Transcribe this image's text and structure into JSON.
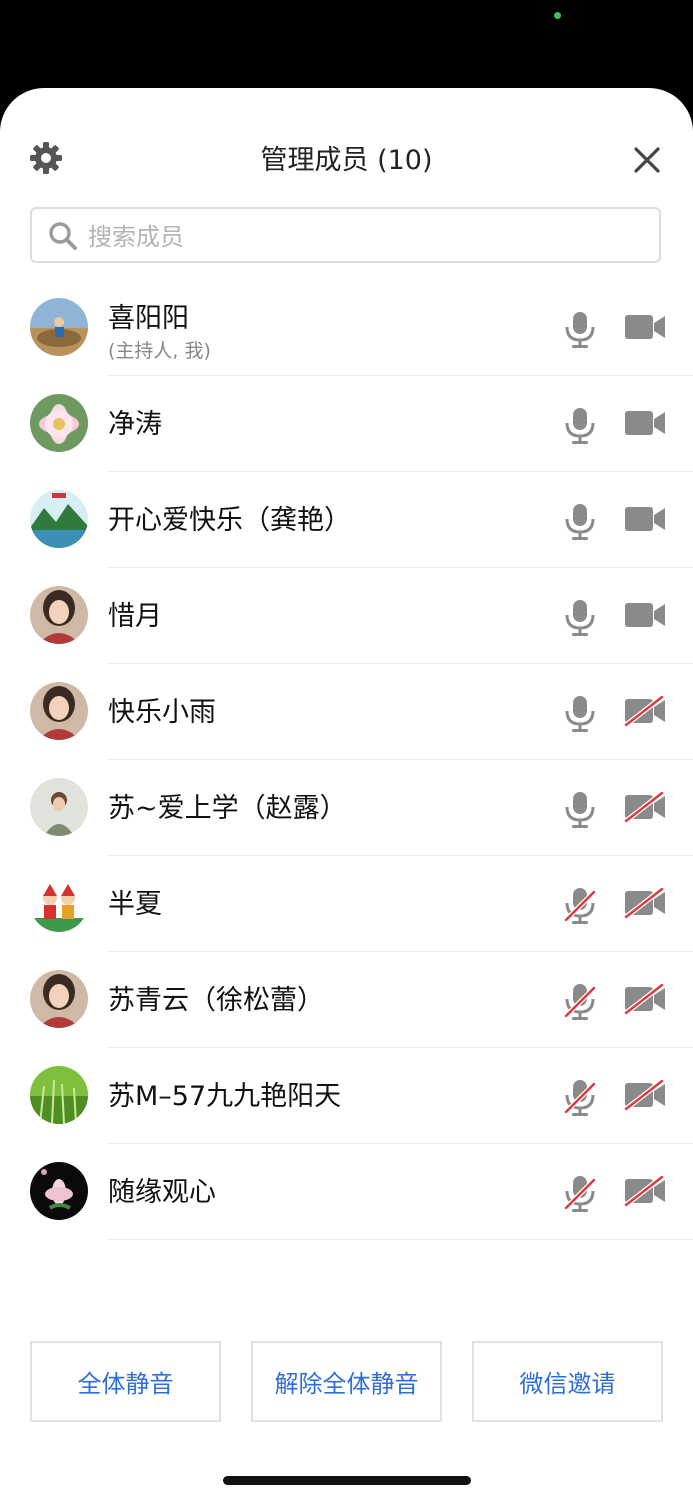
{
  "title": "管理成员 (10)",
  "search": {
    "placeholder": "搜索成员"
  },
  "members": [
    {
      "name": "喜阳阳",
      "sub": "(主持人, 我)",
      "avatar_icon": "landscape-person-avatar",
      "mic_on": true,
      "cam_on": true
    },
    {
      "name": "净涛",
      "avatar_icon": "lotus-flower-avatar",
      "mic_on": true,
      "cam_on": true
    },
    {
      "name": "开心爱快乐（龚艳）",
      "avatar_icon": "mountain-lake-avatar",
      "mic_on": true,
      "cam_on": true
    },
    {
      "name": "惜月",
      "avatar_icon": "woman-portrait-avatar",
      "mic_on": true,
      "cam_on": true
    },
    {
      "name": "快乐小雨",
      "avatar_icon": "woman-portrait-avatar",
      "mic_on": true,
      "cam_on": false
    },
    {
      "name": "苏~爱上学（赵露）",
      "avatar_icon": "person-photo-avatar",
      "mic_on": true,
      "cam_on": false
    },
    {
      "name": "半夏",
      "avatar_icon": "christmas-children-avatar",
      "mic_on": false,
      "cam_on": false
    },
    {
      "name": "苏青云（徐松蕾）",
      "avatar_icon": "woman-portrait-avatar",
      "mic_on": false,
      "cam_on": false
    },
    {
      "name": "苏M–57九九艳阳天",
      "avatar_icon": "green-grass-avatar",
      "mic_on": false,
      "cam_on": false
    },
    {
      "name": "随缘观心",
      "avatar_icon": "lotus-dark-avatar",
      "mic_on": false,
      "cam_on": false
    }
  ],
  "footer": {
    "mute_all": "全体静音",
    "unmute_all": "解除全体静音",
    "wechat_invite": "微信邀请"
  },
  "colors": {
    "accent": "#2f6ed8",
    "icon_gray": "#8a8a8a",
    "muted_red": "#e0383e"
  }
}
